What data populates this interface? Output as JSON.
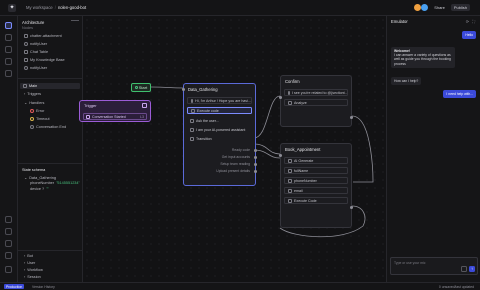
{
  "app": {
    "title_crumb": "My workspace",
    "page_crumb": "nolen-good-bot"
  },
  "topbar": {
    "share_label": "Share",
    "publish_label": "Publish",
    "avatars": [
      "#f0a040",
      "#4aa0f0"
    ]
  },
  "explorer": {
    "title": "Architecture",
    "section_label": "Nodes",
    "items": [
      {
        "label": "chatter-attachment",
        "icon": "attach-icon"
      },
      {
        "label": "notifyUser",
        "icon": "bell-icon"
      },
      {
        "label": "Chat Table",
        "icon": "table-icon"
      },
      {
        "label": "My Knowledge Base",
        "icon": "book-icon"
      },
      {
        "label": "notifyUser",
        "icon": "bell-icon"
      }
    ],
    "workflow": {
      "main": "Main",
      "triggers": "Triggers",
      "handlers": "Handlers",
      "handler_items": [
        "Error",
        "Timeout",
        "Conversation End"
      ]
    },
    "state_title": "State schema",
    "state": {
      "group": "Data_Gathering",
      "phone_key": "phoneNumber",
      "phone_value": "\"5145551234\"",
      "device_key": "device ?",
      "device_value": "\"\""
    },
    "lower": [
      "Bot",
      "User",
      "Workflow",
      "Session"
    ]
  },
  "canvas": {
    "start_label": "Start",
    "trigger": {
      "title": "Trigger",
      "row": "Conversation Started",
      "row_tag": "L3"
    },
    "data_gathering": {
      "title": "Data_Gathering",
      "rows": [
        "Hi, I'm Arthur ! Hope you are havi...",
        "Execute code",
        "Ask the user...",
        "I am your AI-powered assistant",
        "Transition"
      ],
      "outputs": [
        "Ready code",
        "Get input accounts",
        "Setup team reading",
        "Upload present details"
      ]
    },
    "confirm": {
      "title": "Confirm",
      "rows": [
        "I see you're related to @{sectiont...",
        "Analyze"
      ]
    },
    "book": {
      "title": "Book_Appointment",
      "rows": [
        "AI Generate",
        "fullName",
        "phoneNumber",
        "email",
        "Execute Code"
      ]
    }
  },
  "emulator": {
    "title": "Emulator",
    "icons": "⟳ ⛶",
    "messages": [
      {
        "role": "user",
        "text": "Hello"
      },
      {
        "role": "bot",
        "title": "Welcome!",
        "text": "I can answer a variety of questions as well as guide you through the booking process"
      },
      {
        "role": "bot",
        "text": "How can I help?"
      },
      {
        "role": "user",
        "text": "I need help with..."
      }
    ],
    "input_placeholder": "Type or use your mic",
    "send_glyph": "↑"
  },
  "bottombar": {
    "tabs": [
      "Production",
      "Version History"
    ],
    "right": "0 unsaved/last updated"
  },
  "colors": {
    "accent": "#3b4ad9",
    "trigger": "#9b5cd6",
    "start": "#3fbf6e",
    "selected": "#7c8cff"
  }
}
